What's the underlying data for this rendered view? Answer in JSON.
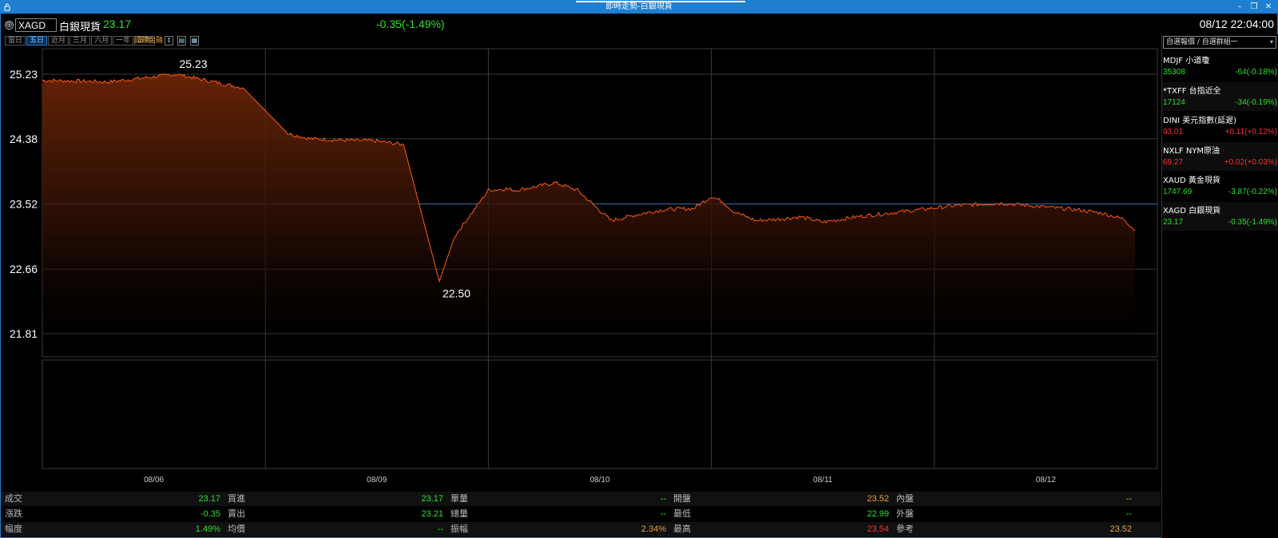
{
  "window": {
    "title": "即時走勢-白銀現貨",
    "minimize": "–",
    "restore": "❐",
    "close": "✕"
  },
  "header": {
    "add_icon": "⊕",
    "symbol": "XAGD",
    "name": "白銀現貨",
    "price": "23.17",
    "change": "-0.35(-1.49%)",
    "datetime": "08/12 22:04:00"
  },
  "toolbar": {
    "periods": [
      "當日",
      "五日",
      "近月",
      "三月",
      "六月",
      "一年",
      "五年"
    ],
    "active_period": "五日",
    "intl_label": "國際金融",
    "icons": [
      "arrows-icon",
      "print-icon",
      "grid-icon"
    ]
  },
  "colors": {
    "up": "#ff3030",
    "down": "#2ee02e",
    "neutral": "#e8a23a",
    "line": "#ff5a14",
    "accent": "#1e7fd0"
  },
  "chart_data": {
    "type": "area",
    "y_ticks": [
      "25.23",
      "24.38",
      "23.52",
      "22.66",
      "21.81"
    ],
    "ylim": [
      21.81,
      25.23
    ],
    "reference_value": 23.52,
    "x_ticks": [
      "08/06",
      "08/09",
      "08/10",
      "08/11",
      "08/12"
    ],
    "annotations": [
      {
        "label": "25.23",
        "type": "high"
      },
      {
        "label": "22.50",
        "type": "low"
      }
    ],
    "series": [
      {
        "x": [
          0,
          0.3,
          0.6,
          0.9,
          1.1,
          1.2,
          1.35,
          1.5,
          1.62,
          1.78,
          1.85,
          1.95,
          2.0,
          2.08,
          2.12,
          2.2,
          2.3,
          2.4,
          2.55,
          2.7,
          2.8,
          2.92,
          3.0,
          3.05,
          3.1,
          3.2,
          3.3,
          3.4,
          3.5,
          3.65,
          3.8,
          3.95,
          4.1,
          4.3,
          4.5,
          4.65,
          4.75,
          4.85,
          4.9
        ],
        "values": [
          25.15,
          25.13,
          25.23,
          25.05,
          24.45,
          24.38,
          24.36,
          24.35,
          24.3,
          22.5,
          23.1,
          23.5,
          23.7,
          23.72,
          23.7,
          23.74,
          23.8,
          23.7,
          23.3,
          23.4,
          23.45,
          23.46,
          23.62,
          23.55,
          23.42,
          23.3,
          23.32,
          23.35,
          23.28,
          23.35,
          23.4,
          23.45,
          23.5,
          23.53,
          23.48,
          23.44,
          23.4,
          23.32,
          23.17
        ]
      }
    ]
  },
  "stats": {
    "rows": [
      [
        {
          "label": "成交",
          "value": "23.17",
          "color": "#2ee02e"
        },
        {
          "label": "買進",
          "value": "23.17",
          "color": "#2ee02e"
        },
        {
          "label": "單量",
          "value": "--",
          "color": "#2ee02e"
        },
        {
          "label": "開盤",
          "value": "23.52",
          "color": "#e8a23a"
        },
        {
          "label": "內盤",
          "value": "--",
          "color": "#e8a23a"
        }
      ],
      [
        {
          "label": "漲跌",
          "value": "-0.35",
          "color": "#2ee02e"
        },
        {
          "label": "賣出",
          "value": "23.21",
          "color": "#2ee02e"
        },
        {
          "label": "總量",
          "value": "--",
          "color": "#2ee02e"
        },
        {
          "label": "最低",
          "value": "22.99",
          "color": "#2ee02e"
        },
        {
          "label": "外盤",
          "value": "--",
          "color": "#2ee02e"
        }
      ],
      [
        {
          "label": "幅度",
          "value": "1.49%",
          "color": "#2ee02e"
        },
        {
          "label": "均價",
          "value": "--",
          "color": "#2ee02e"
        },
        {
          "label": "振幅",
          "value": "2.34%",
          "color": "#e8a23a"
        },
        {
          "label": "最高",
          "value": "23.54",
          "color": "#ff3030"
        },
        {
          "label": "參考",
          "value": "23.52",
          "color": "#e8a23a"
        }
      ]
    ]
  },
  "watchlist": {
    "group": "自選報價 / 自選群組一",
    "items": [
      {
        "name": "MDJF 小道瓊",
        "price": "35308",
        "change": "-64(-0.18%)",
        "color": "#2ee02e"
      },
      {
        "name": "*TXFF 台指近全",
        "price": "17124",
        "change": "-34(-0.19%)",
        "color": "#2ee02e"
      },
      {
        "name": "DINI 美元指數(延遲)",
        "price": "93.01",
        "change": "+0.11(+0.12%)",
        "color": "#ff3030"
      },
      {
        "name": "NXLF NYM原油",
        "price": "69.27",
        "change": "+0.02(+0.03%)",
        "color": "#ff3030"
      },
      {
        "name": "XAUD 黃金現貨",
        "price": "1747.69",
        "change": "-3.87(-0.22%)",
        "color": "#2ee02e"
      },
      {
        "name": "XAGD 白銀現貨",
        "price": "23.17",
        "change": "-0.35(-1.49%)",
        "color": "#2ee02e"
      }
    ]
  }
}
